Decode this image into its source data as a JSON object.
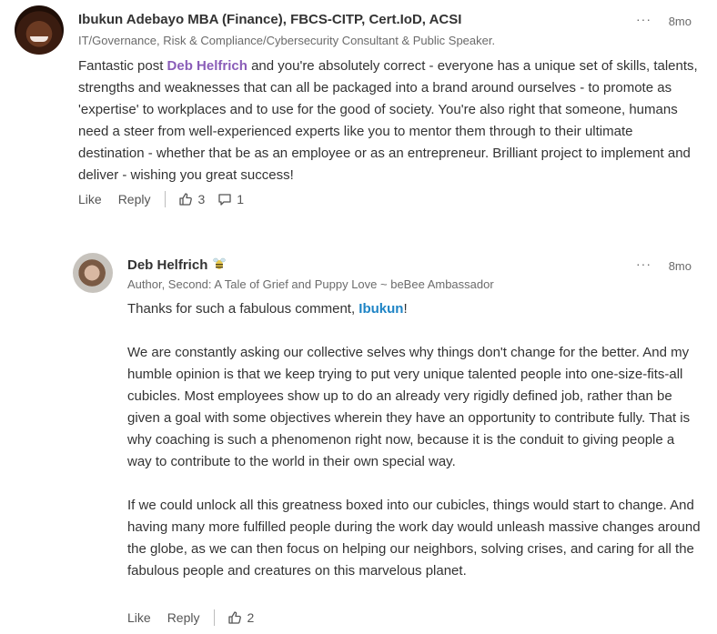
{
  "comments": [
    {
      "author": "Ibukun Adebayo MBA (Finance), FBCS-CITP, Cert.IoD, ACSI",
      "headline": "IT/Governance, Risk & Compliance/Cybersecurity Consultant & Public Speaker.",
      "time": "8mo",
      "body": {
        "p1_pre": "Fantastic post ",
        "p1_mention": "Deb Helfrich",
        "p1_post": " and you're absolutely correct - everyone has a unique set of skills, talents, strengths and weaknesses that can all be packaged into a brand around ourselves - to promote as 'expertise' to workplaces and to use for the good of society. You're also right that someone, humans need a steer from well-experienced experts like you to mentor them through to their ultimate destination - whether that be as an employee or as an entrepreneur. Brilliant project to implement and deliver - wishing you great success!"
      },
      "actions": {
        "like": "Like",
        "reply": "Reply",
        "reactions": "3",
        "replies": "1"
      }
    },
    {
      "author": "Deb Helfrich",
      "headline": "Author, Second: A Tale of Grief and Puppy Love ~ beBee Ambassador",
      "time": "8mo",
      "body": {
        "p1_pre": "Thanks for such a fabulous comment, ",
        "p1_mention": "Ibukun",
        "p1_post": "!",
        "p2": "We are constantly asking our collective selves why things don't change for the better. And my humble opinion is that we keep trying to put very unique talented people into one-size-fits-all cubicles. Most employees show up to do an already very rigidly defined job, rather than be given a goal with some objectives wherein they have an opportunity to contribute fully. That is why coaching is such a phenomenon right now, because it is the conduit to giving people a way to contribute to the world in their own special way.",
        "p3": "If we could unlock all this greatness boxed into our cubicles, things would start to change. And having many more fulfilled people during the work day would unleash massive changes around the globe, as we can then focus on helping our neighbors, solving crises, and caring for all the fabulous people and creatures on this marvelous planet."
      },
      "actions": {
        "like": "Like",
        "reply": "Reply",
        "reactions": "2"
      }
    }
  ],
  "icons": {
    "more": "more-options-icon",
    "reactions": "thumbs-up-icon",
    "replies": "comment-bubble-icon",
    "badge": "bee-badge-icon"
  },
  "colors": {
    "mention_purple": "#8a5db8",
    "mention_blue": "#1e84c5",
    "text": "#333333",
    "muted": "#6b6b6b"
  }
}
